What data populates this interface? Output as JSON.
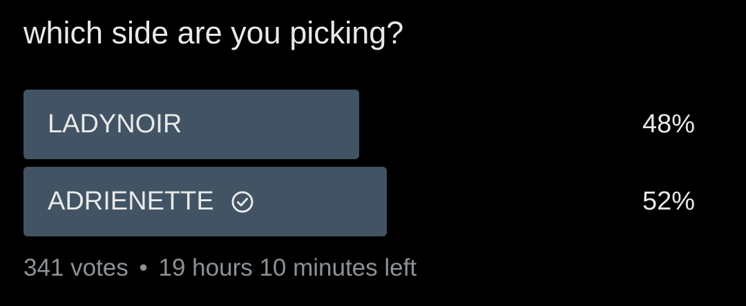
{
  "poll": {
    "question": "which side are you picking?",
    "options": [
      {
        "label": "LADYNOIR",
        "percent": "48%",
        "fill_fraction": 0.48,
        "selected": false
      },
      {
        "label": "ADRIENETTE",
        "percent": "52%",
        "fill_fraction": 0.52,
        "selected": true,
        "icon": "check-circle-icon"
      }
    ],
    "votes": "341 votes",
    "separator": "•",
    "time_left": "19 hours 10 minutes left"
  },
  "colors": {
    "background": "#000000",
    "bar": "#425363",
    "text": "#e7e9ea",
    "muted": "#8b9297"
  }
}
